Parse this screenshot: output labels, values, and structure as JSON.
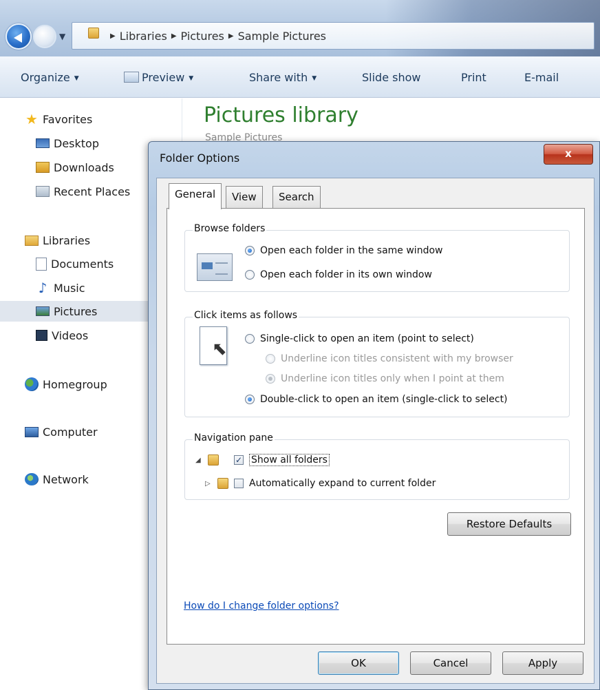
{
  "explorer": {
    "breadcrumbs": [
      "Libraries",
      "Pictures",
      "Sample Pictures"
    ],
    "toolbar": {
      "organize": "Organize",
      "preview": "Preview",
      "share_with": "Share with",
      "slide_show": "Slide show",
      "print": "Print",
      "email": "E-mail"
    },
    "nav": {
      "favorites": "Favorites",
      "desktop": "Desktop",
      "downloads": "Downloads",
      "recent_places": "Recent Places",
      "libraries": "Libraries",
      "documents": "Documents",
      "music": "Music",
      "pictures": "Pictures",
      "videos": "Videos",
      "homegroup": "Homegroup",
      "computer": "Computer",
      "network": "Network"
    },
    "content": {
      "title": "Pictures library",
      "subtitle": "Sample Pictures"
    }
  },
  "dialog": {
    "title": "Folder Options",
    "close_label": "x",
    "tabs": [
      "General",
      "View",
      "Search"
    ],
    "browse": {
      "legend": "Browse folders",
      "opt_same": "Open each folder in the same window",
      "opt_own": "Open each folder in its own window",
      "selected": "same"
    },
    "click": {
      "legend": "Click items as follows",
      "opt_single": "Single-click to open an item (point to select)",
      "opt_underline_browser": "Underline icon titles consistent with my browser",
      "opt_underline_point": "Underline icon titles only when I point at them",
      "opt_double": "Double-click to open an item (single-click to select)",
      "selected": "double"
    },
    "navpane": {
      "legend": "Navigation pane",
      "show_all": "Show all folders",
      "show_all_checked": true,
      "auto_expand": "Automatically expand to current folder",
      "auto_expand_checked": false
    },
    "restore_defaults": "Restore Defaults",
    "help_link": "How do I change folder options?",
    "buttons": {
      "ok": "OK",
      "cancel": "Cancel",
      "apply": "Apply"
    }
  }
}
